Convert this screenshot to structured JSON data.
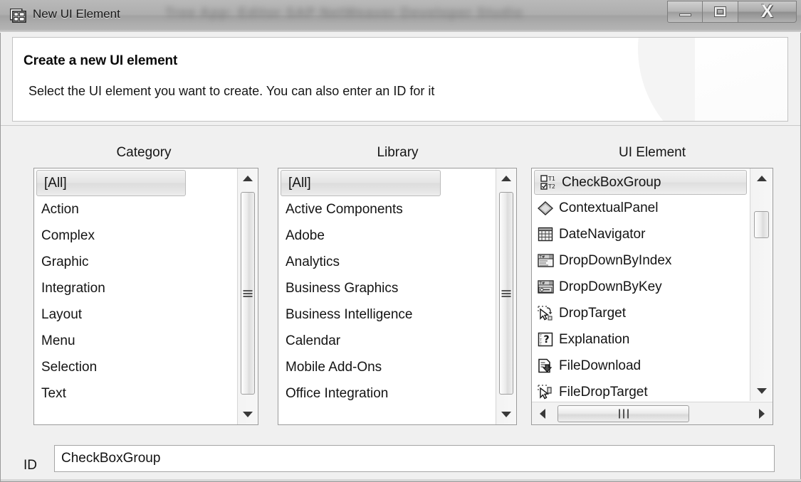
{
  "window": {
    "title": "New UI Element",
    "title_icon": "ui-element-grid-icon",
    "background_blur_text": "Tree  App: Editor   SAP NetWeaver Developer Studio",
    "controls": {
      "minimize_label": "Minimize",
      "maximize_label": "Maximize",
      "close_label": "X"
    }
  },
  "header": {
    "title": "Create a new UI element",
    "description": "Select the UI element you want to create. You can also enter an ID for it"
  },
  "columns": {
    "category_label": "Category",
    "library_label": "Library",
    "element_label": "UI Element"
  },
  "category_list": {
    "selected": "[All]",
    "items": [
      {
        "label": "[All]",
        "selected": true
      },
      {
        "label": "Action",
        "selected": false
      },
      {
        "label": "Complex",
        "selected": false
      },
      {
        "label": "Graphic",
        "selected": false
      },
      {
        "label": "Integration",
        "selected": false
      },
      {
        "label": "Layout",
        "selected": false
      },
      {
        "label": "Menu",
        "selected": false
      },
      {
        "label": "Selection",
        "selected": false
      },
      {
        "label": "Text",
        "selected": false
      },
      {
        "label": "",
        "selected": false
      }
    ]
  },
  "library_list": {
    "selected": "[All]",
    "items": [
      {
        "label": "[All]",
        "selected": true
      },
      {
        "label": "Active Components",
        "selected": false
      },
      {
        "label": "Adobe",
        "selected": false
      },
      {
        "label": "Analytics",
        "selected": false
      },
      {
        "label": "Business Graphics",
        "selected": false
      },
      {
        "label": "Business Intelligence",
        "selected": false
      },
      {
        "label": "Calendar",
        "selected": false
      },
      {
        "label": "Mobile Add-Ons",
        "selected": false
      },
      {
        "label": "Office Integration",
        "selected": false
      },
      {
        "label": "",
        "selected": false
      }
    ]
  },
  "element_list": {
    "selected": "CheckBoxGroup",
    "items": [
      {
        "label": "CheckBoxGroup",
        "icon": "checkboxgroup-icon",
        "selected": true
      },
      {
        "label": "ContextualPanel",
        "icon": "contextualpanel-diamond-icon",
        "selected": false
      },
      {
        "label": "DateNavigator",
        "icon": "datenavigator-grid-icon",
        "selected": false
      },
      {
        "label": "DropDownByIndex",
        "icon": "dropdown-panel-icon",
        "selected": false
      },
      {
        "label": "DropDownByKey",
        "icon": "dropdown-key-icon",
        "selected": false
      },
      {
        "label": "DropTarget",
        "icon": "droptarget-cursor-icon",
        "selected": false
      },
      {
        "label": "Explanation",
        "icon": "explanation-question-icon",
        "selected": false
      },
      {
        "label": "FileDownload",
        "icon": "filedownload-icon",
        "selected": false
      },
      {
        "label": "FileDropTarget",
        "icon": "filedroptarget-icon",
        "selected": false
      }
    ]
  },
  "id_field": {
    "label": "ID",
    "value": "CheckBoxGroup",
    "placeholder": ""
  },
  "colors": {
    "dialog_background": "#f0f0f0",
    "panel_background": "#ffffff",
    "titlebar_gradient_top": "#b9b9b9",
    "titlebar_gradient_bottom": "#cfcfcf",
    "selection_fill": "#e4e4e4",
    "selection_border": "#bcbcbc",
    "text": "#141414",
    "border": "#9b9b9b"
  }
}
